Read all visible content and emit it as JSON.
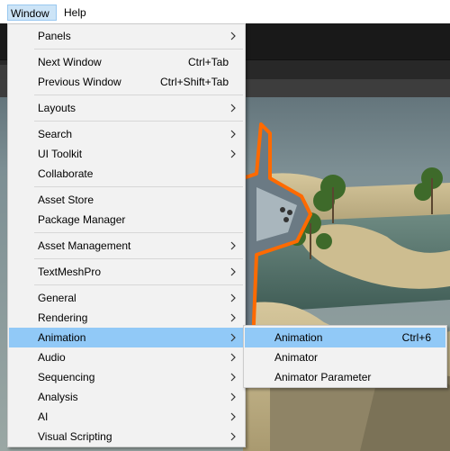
{
  "menubar": {
    "items": [
      "Window",
      "Help"
    ]
  },
  "window_menu": {
    "items": [
      {
        "label": "Panels",
        "submenu": true
      },
      {
        "label": "Next Window",
        "shortcut": "Ctrl+Tab"
      },
      {
        "label": "Previous Window",
        "shortcut": "Ctrl+Shift+Tab"
      },
      {
        "label": "Layouts",
        "submenu": true
      },
      {
        "label": "Search",
        "submenu": true
      },
      {
        "label": "UI Toolkit",
        "submenu": true
      },
      {
        "label": "Collaborate"
      },
      {
        "label": "Asset Store"
      },
      {
        "label": "Package Manager"
      },
      {
        "label": "Asset Management",
        "submenu": true
      },
      {
        "label": "TextMeshPro",
        "submenu": true
      },
      {
        "label": "General",
        "submenu": true
      },
      {
        "label": "Rendering",
        "submenu": true
      },
      {
        "label": "Animation",
        "submenu": true,
        "highlighted": true
      },
      {
        "label": "Audio",
        "submenu": true
      },
      {
        "label": "Sequencing",
        "submenu": true
      },
      {
        "label": "Analysis",
        "submenu": true
      },
      {
        "label": "AI",
        "submenu": true
      },
      {
        "label": "Visual Scripting",
        "submenu": true
      }
    ]
  },
  "animation_submenu": {
    "items": [
      {
        "label": "Animation",
        "shortcut": "Ctrl+6",
        "highlighted": true
      },
      {
        "label": "Animator"
      },
      {
        "label": "Animator Parameter"
      }
    ]
  },
  "colors": {
    "menu_bg": "#f2f2f2",
    "highlight": "#91c9f7",
    "menubar_active": "#cce4f7",
    "selection_outline": "#ff6a00"
  },
  "icons": {
    "submenu_arrow": "chevron-right-icon"
  }
}
